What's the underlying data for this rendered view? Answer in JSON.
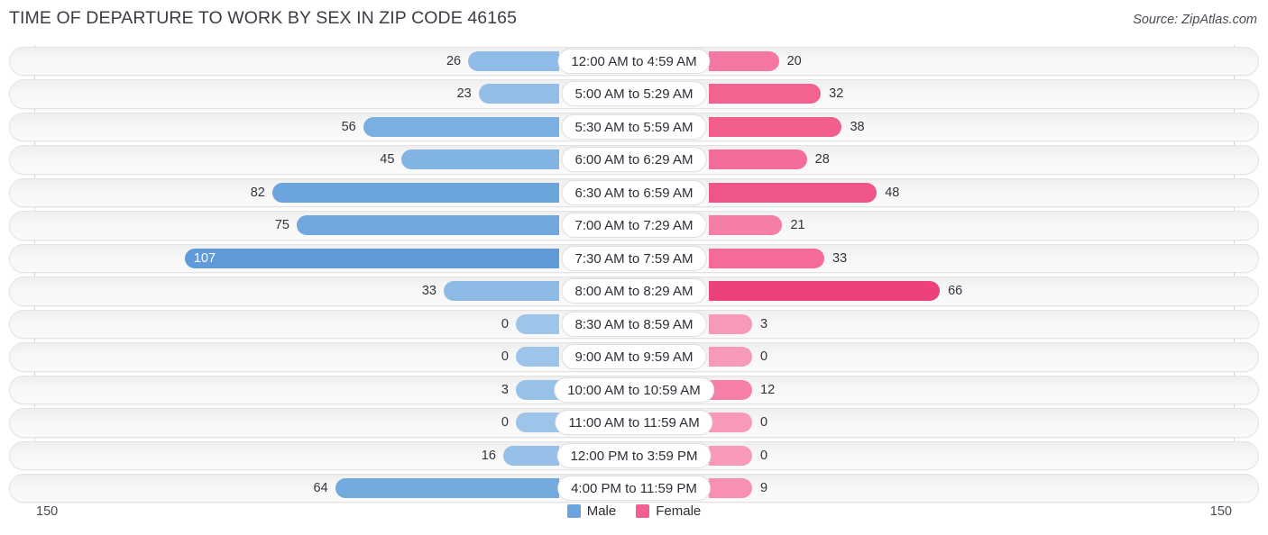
{
  "header": {
    "title": "TIME OF DEPARTURE TO WORK BY SEX IN ZIP CODE 46165",
    "source": "Source: ZipAtlas.com"
  },
  "footer": {
    "axis_left": "150",
    "axis_right": "150",
    "legend": [
      {
        "label": "Male",
        "color": "#6ba3dc"
      },
      {
        "label": "Female",
        "color": "#f2608f"
      }
    ]
  },
  "chart_data": {
    "type": "bar",
    "subtype": "diverging-bidirectional",
    "title": "TIME OF DEPARTURE TO WORK BY SEX IN ZIP CODE 46165",
    "xlabel": "",
    "ylabel": "",
    "xlim": [
      -150,
      150
    ],
    "axis_max": 150,
    "grid": false,
    "legend_position": "bottom-center",
    "categories": [
      "12:00 AM to 4:59 AM",
      "5:00 AM to 5:29 AM",
      "5:30 AM to 5:59 AM",
      "6:00 AM to 6:29 AM",
      "6:30 AM to 6:59 AM",
      "7:00 AM to 7:29 AM",
      "7:30 AM to 7:59 AM",
      "8:00 AM to 8:29 AM",
      "8:30 AM to 8:59 AM",
      "9:00 AM to 9:59 AM",
      "10:00 AM to 10:59 AM",
      "11:00 AM to 11:59 AM",
      "12:00 PM to 3:59 PM",
      "4:00 PM to 11:59 PM"
    ],
    "series": [
      {
        "name": "Male",
        "color": "#6ba3dc",
        "values": [
          26,
          23,
          56,
          45,
          82,
          75,
          107,
          33,
          0,
          0,
          3,
          0,
          16,
          64
        ]
      },
      {
        "name": "Female",
        "color": "#f2608f",
        "values": [
          20,
          32,
          38,
          28,
          48,
          21,
          33,
          66,
          3,
          0,
          12,
          0,
          0,
          9
        ]
      }
    ]
  },
  "rows": [
    {
      "category": "12:00 AM to 4:59 AM",
      "male": 26,
      "female": 20,
      "male_label": "26",
      "female_label": "20",
      "male_color": "#8fbce6",
      "female_color": "#f478a0"
    },
    {
      "category": "5:00 AM to 5:29 AM",
      "male": 23,
      "female": 32,
      "male_label": "23",
      "female_label": "32",
      "male_color": "#92bee7",
      "female_color": "#f2638f"
    },
    {
      "category": "5:30 AM to 5:59 AM",
      "male": 56,
      "female": 38,
      "male_label": "56",
      "female_label": "38",
      "male_color": "#7aafe0",
      "female_color": "#f25f8c"
    },
    {
      "category": "6:00 AM to 6:29 AM",
      "male": 45,
      "female": 28,
      "male_label": "45",
      "female_label": "28",
      "male_color": "#82b4e3",
      "female_color": "#f46d98"
    },
    {
      "category": "6:30 AM to 6:59 AM",
      "male": 82,
      "female": 48,
      "male_label": "82",
      "female_label": "48",
      "male_color": "#6ba3dc",
      "female_color": "#f0558a"
    },
    {
      "category": "7:00 AM to 7:29 AM",
      "male": 75,
      "female": 21,
      "male_label": "75",
      "female_label": "21",
      "male_color": "#6fa7de",
      "female_color": "#f67da4"
    },
    {
      "category": "7:30 AM to 7:59 AM",
      "male": 107,
      "female": 33,
      "male_label": "107",
      "female_label": "33",
      "male_color": "#5f9bd8",
      "female_color": "#f46b97"
    },
    {
      "category": "8:00 AM to 8:29 AM",
      "male": 33,
      "female": 66,
      "male_label": "33",
      "female_label": "66",
      "male_color": "#8cbae5",
      "female_color": "#ed417c"
    },
    {
      "category": "8:30 AM to 8:59 AM",
      "male": 0,
      "female": 3,
      "male_label": "0",
      "female_label": "3",
      "male_color": "#9dc5ea",
      "female_color": "#f79ab8"
    },
    {
      "category": "9:00 AM to 9:59 AM",
      "male": 0,
      "female": 0,
      "male_label": "0",
      "female_label": "0",
      "male_color": "#9dc5ea",
      "female_color": "#f79ab8"
    },
    {
      "category": "10:00 AM to 10:59 AM",
      "male": 3,
      "female": 12,
      "male_label": "3",
      "female_label": "12",
      "male_color": "#98c1e8",
      "female_color": "#f77fa6"
    },
    {
      "category": "11:00 AM to 11:59 AM",
      "male": 0,
      "female": 0,
      "male_label": "0",
      "female_label": "0",
      "male_color": "#9dc5ea",
      "female_color": "#f79ab8"
    },
    {
      "category": "12:00 PM to 3:59 PM",
      "male": 16,
      "female": 0,
      "male_label": "16",
      "female_label": "0",
      "male_color": "#96c0e8",
      "female_color": "#f79ab8"
    },
    {
      "category": "4:00 PM to 11:59 PM",
      "male": 64,
      "female": 9,
      "male_label": "64",
      "female_label": "9",
      "male_color": "#73aade",
      "female_color": "#f790b1"
    }
  ]
}
